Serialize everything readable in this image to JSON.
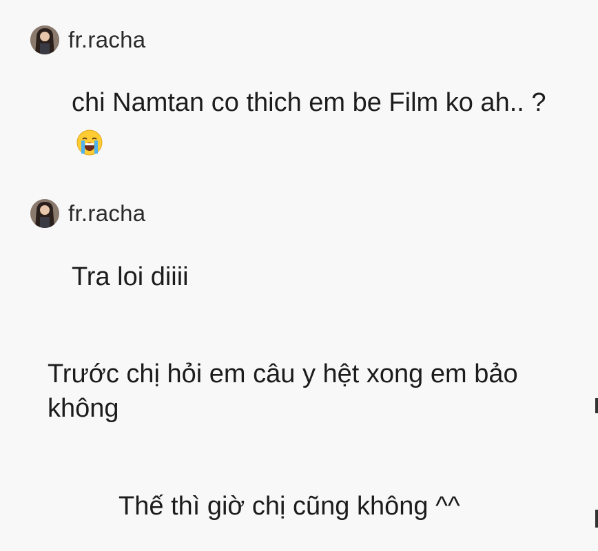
{
  "thread": {
    "comments": [
      {
        "username": "fr.racha",
        "text": "chi Namtan co thich em be Film ko ah.. ?",
        "emoji": "loudly-crying-face-icon"
      },
      {
        "username": "fr.racha",
        "text": "Tra loi diiii"
      }
    ],
    "reply": {
      "line1": "Trước chị hỏi em câu y hệt xong em bảo không",
      "line2": "Thế thì giờ chị cũng không ^^"
    }
  },
  "colors": {
    "background": "#f8f8f8",
    "text": "#1c1c1c",
    "emoji_face": "#ffcc33",
    "emoji_tears": "#4fb3f0"
  }
}
